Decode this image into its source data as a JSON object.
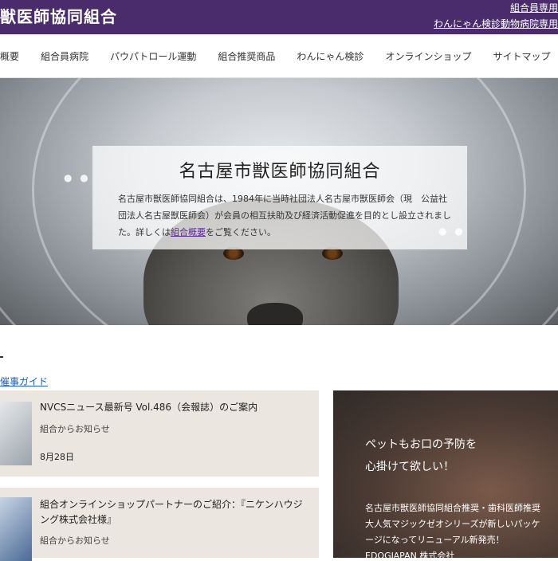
{
  "header": {
    "title": "獣医師協同組合",
    "links": [
      "組合員専用",
      "わんにゃん検診動物病院専用"
    ]
  },
  "nav": {
    "items": [
      "概要",
      "組合員病院",
      "パウパトロール運動",
      "組合推奨商品",
      "わんにゃん検診",
      "オンラインショップ",
      "サイトマップ"
    ]
  },
  "hero": {
    "title": "名古屋市獣医師協同組合",
    "text_before": "名古屋市獣医師協同組合は、1984年に当時社団法人名古屋市獣医師会（現　公益社団法人名古屋獣医師会）が会員の相互扶助及び経済活動促進を目的とし設立されました。詳しくは",
    "link": "組合概要",
    "text_after": "をご覧ください。"
  },
  "event_guide": "催事ガイド",
  "news": [
    {
      "title": "NVCSニュース最新号 Vol.486（会報誌）のご案内",
      "category": "組合からお知らせ",
      "date": "8月28日"
    },
    {
      "title": "組合オンラインショップパートナーのご紹介：『ニケンハウジング株式会社様』",
      "category": "組合からお知らせ",
      "date": ""
    }
  ],
  "promo": {
    "headline": [
      "ペットもお口の予防を",
      "心掛けて欲しい！"
    ],
    "body": [
      "名古屋市獣医師協同組合推奨・歯科医師推奨",
      "大人気マジックゼオシリーズが新しいパッケ",
      "ージになってリニューアル新発売！",
      "EDOGJAPAN 株式会社"
    ]
  },
  "colors": {
    "header_bg": "#4a2c6d",
    "link": "#1a5fb4",
    "news_bg": "#ebe6df"
  }
}
